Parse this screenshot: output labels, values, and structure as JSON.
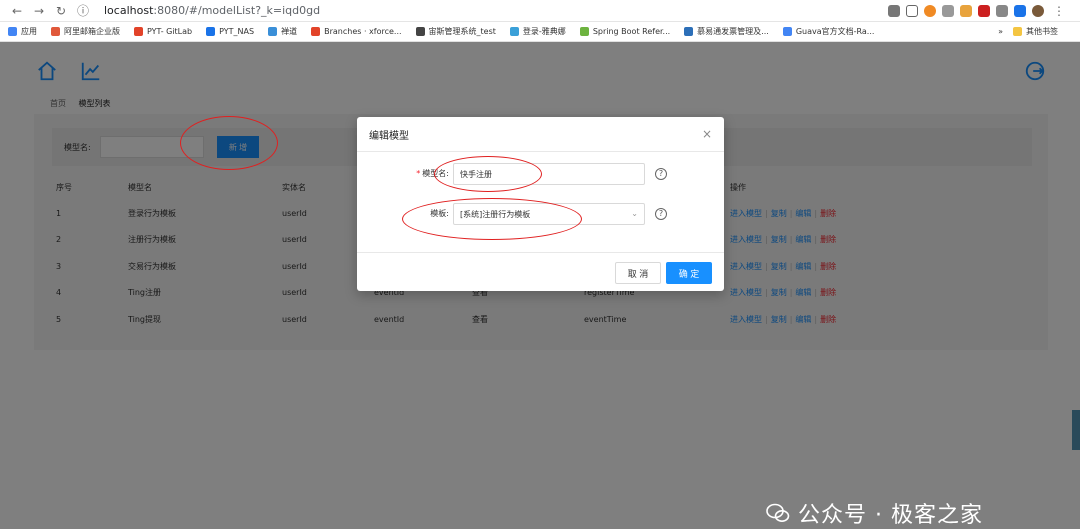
{
  "browser": {
    "url_host": "localhost",
    "url_rest": ":8080/#/modelList?_k=iqd0gd",
    "bookmarks": [
      {
        "label": "应用",
        "color": "#4285f4"
      },
      {
        "label": "阿里邮箱企业版",
        "color": "#e0583a"
      },
      {
        "label": "PYT- GitLab",
        "color": "#e24329"
      },
      {
        "label": "PYT_NAS",
        "color": "#1a73e8"
      },
      {
        "label": "禅道",
        "color": "#3a8fd8"
      },
      {
        "label": "Branches · xforce...",
        "color": "#e24329"
      },
      {
        "label": "宙斯管理系统_test",
        "color": "#444444"
      },
      {
        "label": "登录-雅典娜",
        "color": "#3aa0d8"
      },
      {
        "label": "Spring Boot Refer...",
        "color": "#6db33f"
      },
      {
        "label": "慕易通发票管理及...",
        "color": "#2c6fb8"
      },
      {
        "label": "Guava官方文档-Ra...",
        "color": "#4285f4"
      }
    ],
    "bookmarks_more": "»",
    "other_bookmarks": "其他书签"
  },
  "breadcrumb": {
    "home": "首页",
    "current": "模型列表"
  },
  "filter": {
    "label": "模型名:",
    "new_button": "新 增"
  },
  "table": {
    "headers": [
      "序号",
      "模型名",
      "实体名",
      "",
      "",
      "",
      "操作"
    ],
    "rows": [
      {
        "no": "1",
        "name": "登录行为模板",
        "entity": "userId",
        "c4": "",
        "c5": "",
        "c6": ""
      },
      {
        "no": "2",
        "name": "注册行为模板",
        "entity": "userId",
        "c4": "",
        "c5": "",
        "c6": ""
      },
      {
        "no": "3",
        "name": "交易行为模板",
        "entity": "userId",
        "c4": "",
        "c5": "",
        "c6": ""
      },
      {
        "no": "4",
        "name": "Ting注册",
        "entity": "userId",
        "c4": "eventId",
        "c5": "查看",
        "c6": "registerTime"
      },
      {
        "no": "5",
        "name": "Ting提现",
        "entity": "userId",
        "c4": "eventId",
        "c5": "查看",
        "c6": "eventTime"
      }
    ],
    "ops": {
      "enter": "进入模型",
      "copy": "复制",
      "edit": "编辑",
      "delete": "删除"
    }
  },
  "modal": {
    "title": "编辑模型",
    "close": "×",
    "name_label": "模型名:",
    "name_required": "*",
    "name_value": "快手注册",
    "template_label": "模板:",
    "template_value": "[系统]注册行为模板",
    "help": "?",
    "cancel": "取 消",
    "ok": "确 定"
  },
  "watermark": "公众号 · 极客之家",
  "colors": {
    "primary": "#1890ff",
    "danger": "#f5222d",
    "annotation": "#e02020"
  }
}
